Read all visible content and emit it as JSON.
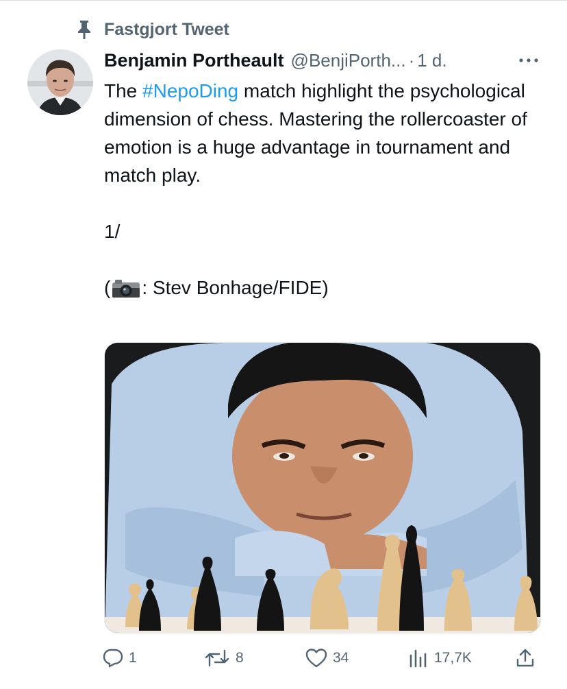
{
  "pinned": {
    "label": "Fastgjort Tweet",
    "icon": "pin-icon"
  },
  "author": {
    "name": "Benjamin Portheault",
    "handle": "@BenjiPorth...",
    "separator": "·",
    "time": "1 d."
  },
  "tweet": {
    "line1_before": "The ",
    "hashtag": "#NepoDing",
    "line1_after": " match highlight the psychological dimension of chess. Mastering the rollercoaster of emotion  is a huge advantage in tournament and match play.",
    "thread_marker": "1/",
    "credit_open": "(",
    "credit_text": ": Stev Bonhage/FIDE)"
  },
  "actions": {
    "replies": "1",
    "retweets": "8",
    "likes": "34",
    "views": "17,7K"
  },
  "colors": {
    "accent": "#1d9bf0",
    "secondary_text": "#536471",
    "primary_text": "#0f1419"
  }
}
